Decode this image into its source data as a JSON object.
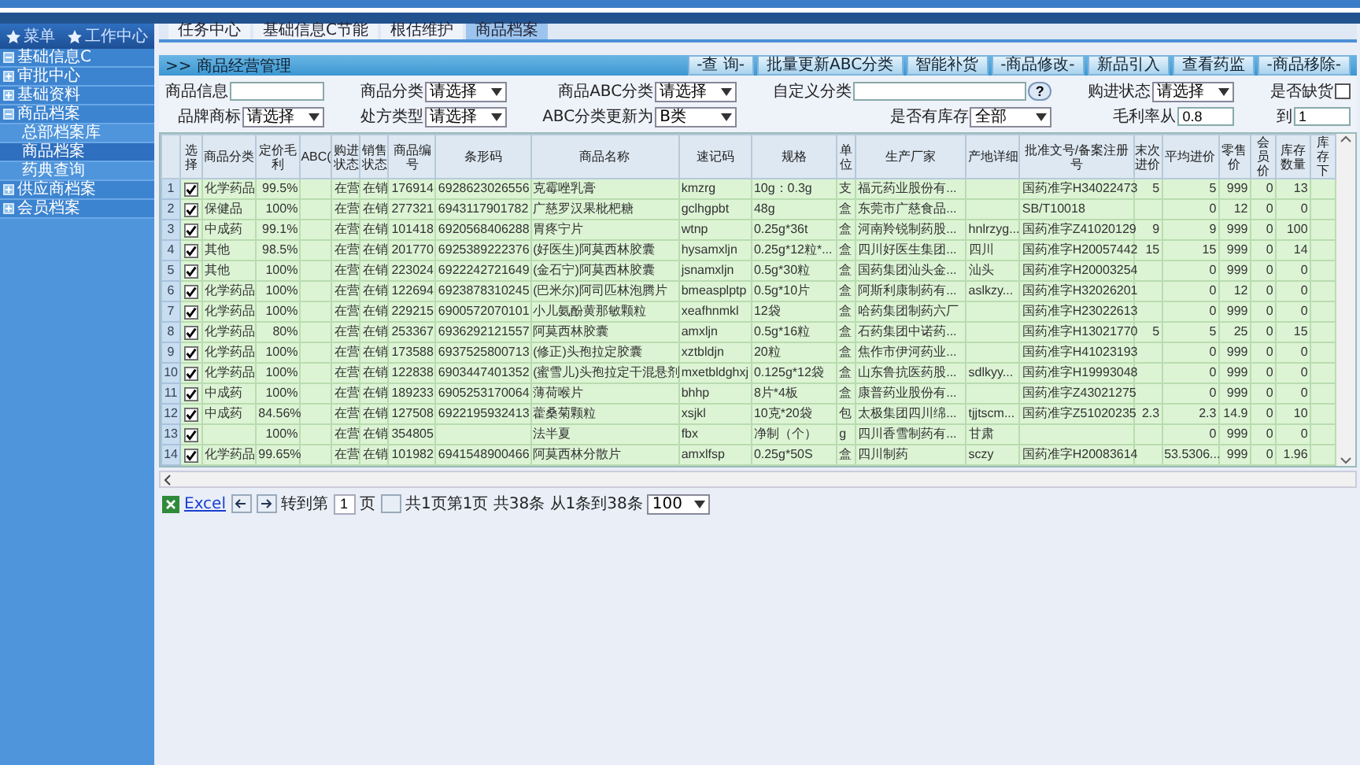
{
  "sidebar": {
    "tabs": [
      {
        "label": "菜单"
      },
      {
        "label": "工作中心"
      }
    ],
    "items": [
      {
        "label": "基础信息C",
        "expanded": true
      },
      {
        "label": "审批中心",
        "expanded": false
      },
      {
        "label": "基础资料",
        "expanded": false
      },
      {
        "label": "商品档案",
        "expanded": true,
        "children": [
          {
            "label": "总部档案库",
            "selected": false
          },
          {
            "label": "商品档案",
            "selected": true
          },
          {
            "label": "药典查询",
            "selected": false
          }
        ]
      },
      {
        "label": "供应商档案",
        "expanded": false
      },
      {
        "label": "会员档案",
        "expanded": false
      }
    ]
  },
  "tabs": [
    {
      "label": "任务中心",
      "selected": false
    },
    {
      "label": "基础信息C节能",
      "selected": false
    },
    {
      "label": "根估维护",
      "selected": false
    },
    {
      "label": "商品档案",
      "selected": true
    }
  ],
  "panel_title": ">> 商品经营管理",
  "buttons": [
    "-查 询-",
    "批量更新ABC分类",
    "智能补货",
    "-商品修改-",
    "新品引入",
    "查看药监",
    "-商品移除-"
  ],
  "filters": [
    {
      "kind": "input",
      "label": "商品信息"
    },
    {
      "kind": "select",
      "label": "商品分类",
      "value": "请选择"
    },
    {
      "kind": "select",
      "label": "商品ABC分类",
      "value": "请选择"
    },
    {
      "kind": "help",
      "label": "自定义分类",
      "help": "?"
    },
    {
      "kind": "select",
      "label": "购进状态",
      "value": "请选择"
    },
    {
      "kind": "checkbox",
      "label": "是否缺货",
      "checked": false
    },
    {
      "kind": "select",
      "label": "品牌商标",
      "value": "请选择"
    },
    {
      "kind": "select",
      "label": "处方类型",
      "value": "请选择"
    },
    {
      "kind": "select",
      "label": "ABC分类更新为",
      "value": "B类"
    },
    {
      "kind": "select",
      "label": "是否有库存",
      "value": "全部"
    },
    {
      "kind": "input",
      "label": "毛利率从",
      "value": "0.8"
    },
    {
      "kind": "input",
      "label": "到",
      "value": "1"
    }
  ],
  "table": {
    "columns": [
      "选择",
      "商品分类",
      "定价毛利",
      "ABC(",
      "购进状态",
      "销售状态",
      "商品编号",
      "条形码",
      "商品名称",
      "速记码",
      "规格",
      "单位",
      "生产厂家",
      "产地详细",
      "批准文号/备案注册号",
      "末次进价",
      "平均进价",
      "零售价",
      "会员价",
      "库存数量",
      "库存下"
    ],
    "rows": [
      {
        "num": "1",
        "checked": true,
        "cells": [
          "",
          "化学药品",
          "99.5%",
          null,
          "在营",
          "在销",
          "176914",
          "6928623026556",
          "克霉唑乳膏",
          "kmzrg",
          "10g：0.3g",
          "支",
          "福元药业股份有...",
          null,
          "国药准字H34022473",
          "5",
          "5",
          "999",
          "0",
          "13",
          null
        ]
      },
      {
        "num": "2",
        "checked": true,
        "cells": [
          "",
          "保健品",
          "100%",
          null,
          "在营",
          "在销",
          "277321",
          "6943117901782",
          "广慈罗汉果枇杷糖",
          "gclhgpbt",
          "48g",
          "盒",
          "东莞市广慈食品...",
          null,
          "SB/T10018",
          null,
          "0",
          "12",
          "0",
          "0",
          null
        ]
      },
      {
        "num": "3",
        "checked": true,
        "cells": [
          "",
          "中成药",
          "99.1%",
          null,
          "在营",
          "在销",
          "101418",
          "6920568406288",
          "胃疼宁片",
          "wtnp",
          "0.25g*36t",
          "盒",
          "河南羚锐制药股...",
          "hnlrzyg...",
          "国药准字Z41020129",
          "9",
          "9",
          "999",
          "0",
          "100",
          null
        ]
      },
      {
        "num": "4",
        "checked": true,
        "cells": [
          "",
          "其他",
          "98.5%",
          null,
          "在营",
          "在销",
          "201770",
          "6925389222376",
          "(好医生)阿莫西林胶囊",
          "hysamxljn",
          "0.25g*12粒*...",
          "盒",
          "四川好医生集团...",
          "四川",
          "国药准字H20057442",
          "15",
          "15",
          "999",
          "0",
          "14",
          null
        ]
      },
      {
        "num": "5",
        "checked": true,
        "cells": [
          "",
          "其他",
          "100%",
          null,
          "在营",
          "在销",
          "223024",
          "6922242721649",
          "(金石宁)阿莫西林胶囊",
          "jsnamxljn",
          "0.5g*30粒",
          "盒",
          "国药集团汕头金...",
          "汕头",
          "国药准字H20003254",
          null,
          "0",
          "999",
          "0",
          "0",
          null
        ]
      },
      {
        "num": "6",
        "checked": true,
        "cells": [
          "",
          "化学药品",
          "100%",
          null,
          "在营",
          "在销",
          "122694",
          "6923878310245",
          "(巴米尔)阿司匹林泡腾片",
          "bmeasplptp",
          "0.5g*10片",
          "盒",
          "阿斯利康制药有...",
          "aslkzy...",
          "国药准字H32026201",
          null,
          "0",
          "12",
          "0",
          "0",
          null
        ]
      },
      {
        "num": "7",
        "checked": true,
        "cells": [
          "",
          "化学药品",
          "100%",
          null,
          "在营",
          "在销",
          "229215",
          "6900572070101",
          "小儿氨酚黄那敏颗粒",
          "xeafhnmkl",
          "12袋",
          "盒",
          "哈药集团制药六厂",
          null,
          "国药准字H23022613",
          null,
          "0",
          "999",
          "0",
          "0",
          null
        ]
      },
      {
        "num": "8",
        "checked": true,
        "cells": [
          "",
          "化学药品",
          "80%",
          null,
          "在营",
          "在销",
          "253367",
          "6936292121557",
          "阿莫西林胶囊",
          "amxljn",
          "0.5g*16粒",
          "盒",
          "石药集团中诺药...",
          null,
          "国药准字H13021770",
          "5",
          "5",
          "25",
          "0",
          "15",
          null
        ]
      },
      {
        "num": "9",
        "checked": true,
        "cells": [
          "",
          "化学药品",
          "100%",
          null,
          "在营",
          "在销",
          "173588",
          "6937525800713",
          "(修正)头孢拉定胶囊",
          "xztbldjn",
          "20粒",
          "盒",
          "焦作市伊河药业...",
          null,
          "国药准字H41023193",
          null,
          "0",
          "999",
          "0",
          "0",
          null
        ]
      },
      {
        "num": "10",
        "checked": true,
        "cells": [
          "",
          "化学药品",
          "100%",
          null,
          "在营",
          "在销",
          "122838",
          "6903447401352",
          "(蜜雪儿)头孢拉定干混悬剂",
          "mxetbldghxj",
          "0.125g*12袋",
          "盒",
          "山东鲁抗医药股...",
          "sdlkyy...",
          "国药准字H19993048",
          null,
          "0",
          "999",
          "0",
          "0",
          null
        ]
      },
      {
        "num": "11",
        "checked": true,
        "cells": [
          "",
          "中成药",
          "100%",
          null,
          "在营",
          "在销",
          "189233",
          "6905253170064",
          "薄荷喉片",
          "bhhp",
          "8片*4板",
          "盒",
          "康普药业股份有...",
          null,
          "国药准字Z43021275",
          null,
          "0",
          "999",
          "0",
          "0",
          null
        ]
      },
      {
        "num": "12",
        "checked": true,
        "cells": [
          "",
          "中成药",
          "84.56%",
          null,
          "在营",
          "在销",
          "127508",
          "6922195932413",
          "藿桑菊颗粒",
          "xsjkl",
          "10克*20袋",
          "包",
          "太极集团四川绵...",
          "tjjtscm...",
          "国药准字Z51020235",
          "2.3",
          "2.3",
          "14.9",
          "0",
          "10",
          null
        ]
      },
      {
        "num": "13",
        "checked": true,
        "cells": [
          "",
          null,
          "100%",
          null,
          "在营",
          "在销",
          "354805",
          null,
          "法半夏",
          "fbx",
          "净制（个）",
          "g",
          "四川香雪制药有...",
          "甘肃",
          null,
          null,
          "0",
          "999",
          "0",
          "0",
          null
        ]
      },
      {
        "num": "14",
        "checked": true,
        "cells": [
          "",
          "化学药品",
          "99.65%",
          null,
          "在营",
          "在销",
          "101982",
          "6941548900466",
          "阿莫西林分散片",
          "amxlfsp",
          "0.25g*50S",
          "盒",
          "四川制药",
          "sczy",
          "国药准字H20083614",
          null,
          "53.5306...",
          "999",
          "0",
          "1.96",
          null
        ]
      }
    ]
  },
  "pager": {
    "export": "Excel",
    "goto": "转到第",
    "page": "1",
    "unit": "页",
    "summary": "共1页第1页 共38条 从1条到38条",
    "page_size": "100"
  }
}
